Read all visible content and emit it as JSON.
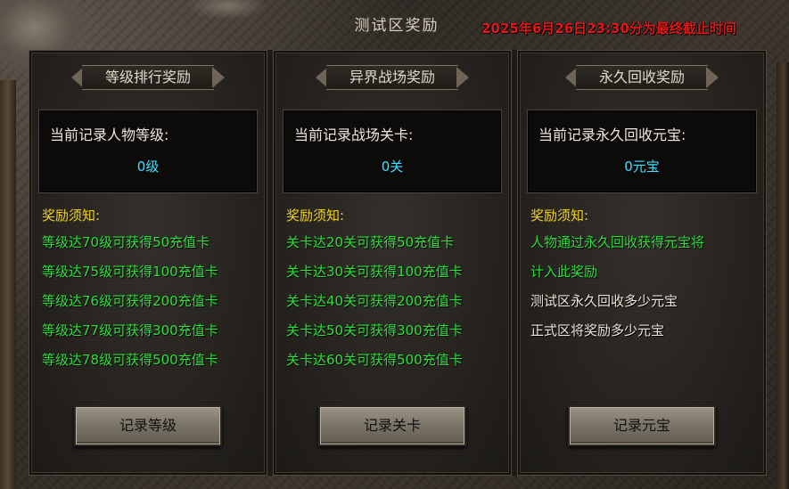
{
  "window": {
    "title": "测试区奖励",
    "deadline": "2025年6月26日23:30分为最终截止时间"
  },
  "colors": {
    "deadline": "#e01818",
    "value": "#3fe0ff",
    "notice_title": "#f0d020",
    "reward_rule": "#2ee03a",
    "plain_text": "#ece6da"
  },
  "panels": [
    {
      "header": "等级排行奖励",
      "record_label": "当前记录人物等级:",
      "record_value": "0级",
      "notice_title": "奖励须知:",
      "rules": [
        "等级达70级可获得50充值卡",
        "等级达75级可获得100充值卡",
        "等级达76级可获得200充值卡",
        "等级达77级可获得300充值卡",
        "等级达78级可获得500充值卡"
      ],
      "button": "记录等级"
    },
    {
      "header": "异界战场奖励",
      "record_label": "当前记录战场关卡:",
      "record_value": "0关",
      "notice_title": "奖励须知:",
      "rules": [
        "关卡达20关可获得50充值卡",
        "关卡达30关可获得100充值卡",
        "关卡达40关可获得200充值卡",
        "关卡达50关可获得300充值卡",
        "关卡达60关可获得500充值卡"
      ],
      "button": "记录关卡"
    },
    {
      "header": "永久回收奖励",
      "record_label": "当前记录永久回收元宝:",
      "record_value": "0元宝",
      "notice_title": "奖励须知:",
      "rules": [
        "人物通过永久回收获得元宝将",
        "计入此奖励",
        "测试区永久回收多少元宝",
        "正式区将奖励多少元宝"
      ],
      "button": "记录元宝"
    }
  ]
}
